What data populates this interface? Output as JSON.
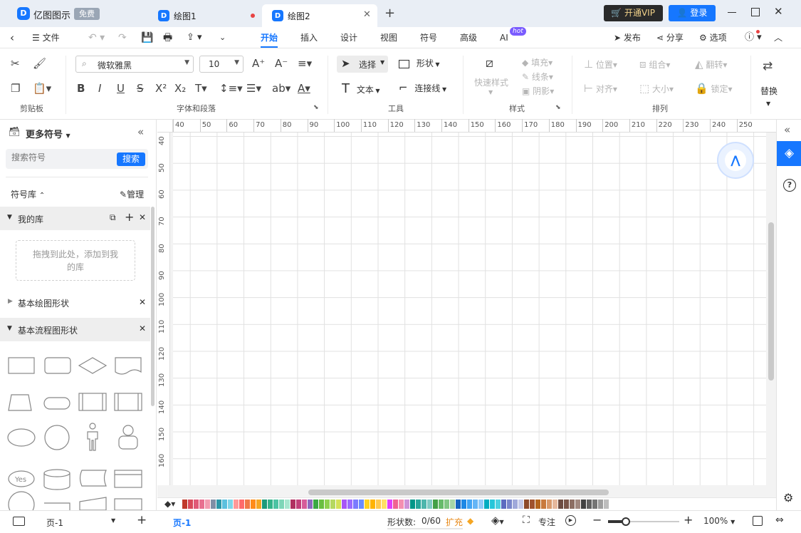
{
  "app": {
    "name": "亿图图示",
    "badge": "免费",
    "vip_label": "开通VIP",
    "login_label": "登录"
  },
  "tabs": [
    {
      "label": "绘图1"
    },
    {
      "label": "绘图2"
    }
  ],
  "menu": {
    "file": "文件",
    "items": [
      "开始",
      "插入",
      "设计",
      "视图",
      "符号",
      "高级",
      "AI"
    ],
    "ai_badge": "hot",
    "publish": "发布",
    "share": "分享",
    "options": "选项"
  },
  "ribbon": {
    "clipboard_label": "剪贴板",
    "font_name": "微软雅黑",
    "font_size": "10",
    "font_group_label": "字体和段落",
    "select": "选择",
    "shape": "形状",
    "text": "文本",
    "connector": "连接线",
    "tools_label": "工具",
    "quick_style": "快速样式",
    "fill": "填充",
    "line": "线条",
    "shadow": "阴影",
    "style_label": "样式",
    "position": "位置",
    "group": "组合",
    "flip": "翻转",
    "align": "对齐",
    "size": "大小",
    "lock": "锁定",
    "arrange_label": "排列",
    "replace": "替换"
  },
  "left_panel": {
    "title": "更多符号",
    "search_placeholder": "搜索符号",
    "search_button": "搜索",
    "library_label": "符号库",
    "manage_label": "管理",
    "my_library": "我的库",
    "drop_hint": "拖拽到此处，添加到我的库",
    "basic_shapes": "基本绘图形状",
    "flowchart_shapes": "基本流程图形状",
    "yes_label": "Yes"
  },
  "rulers": {
    "h": [
      "40",
      "50",
      "60",
      "70",
      "80",
      "90",
      "100",
      "110",
      "120",
      "130",
      "140",
      "150",
      "160",
      "170",
      "180",
      "190",
      "200",
      "210",
      "220",
      "230",
      "240",
      "250"
    ],
    "v": [
      "40",
      "50",
      "60",
      "70",
      "80",
      "90",
      "100",
      "110",
      "120",
      "130",
      "140",
      "150",
      "160"
    ]
  },
  "status": {
    "page_name": "页-1",
    "page_tab": "页-1",
    "shape_count_label": "形状数:",
    "shape_count": "0/60",
    "expand": "扩充",
    "focus": "专注",
    "zoom": "100%"
  },
  "palette": [
    "#c0392b",
    "#d84a5b",
    "#e05a78",
    "#e87090",
    "#f29bb0",
    "#7f8fa6",
    "#2c97a8",
    "#5bc0de",
    "#7fd6e8",
    "#ff9999",
    "#ff6b6b",
    "#f07848",
    "#ff8c1a",
    "#f5a623",
    "#1a9a7a",
    "#34b38a",
    "#4cc3a3",
    "#7ed6b8",
    "#a8e6cf",
    "#b03060",
    "#c2407a",
    "#d65c9a",
    "#8e6bbf",
    "#3aa845",
    "#6abf40",
    "#8fd14f",
    "#b5d860",
    "#d4e157",
    "#a855f7",
    "#9b6bff",
    "#7a7aff",
    "#6a8cff",
    "#ffd21f",
    "#ffb300",
    "#ffc94d",
    "#ffe066",
    "#e040fb",
    "#f06292",
    "#f48fb1",
    "#ce93d8",
    "#009688",
    "#26a69a",
    "#4db6ac",
    "#80cbc4",
    "#43a047",
    "#66bb6a",
    "#81c784",
    "#a5d6a7",
    "#1565c0",
    "#1e88e5",
    "#42a5f5",
    "#64b5f6",
    "#90caf9",
    "#00acc1",
    "#26c6da",
    "#4dd0e1",
    "#5c6bc0",
    "#7986cb",
    "#9fa8da",
    "#c5cae9",
    "#8d4a2b",
    "#a0522d",
    "#b5651d",
    "#c97a3d",
    "#d99a6c",
    "#e6b89c",
    "#6d4c41",
    "#795548",
    "#8d6e63",
    "#a1887f",
    "#424242",
    "#616161",
    "#757575",
    "#9e9e9e",
    "#bdbdbd"
  ]
}
